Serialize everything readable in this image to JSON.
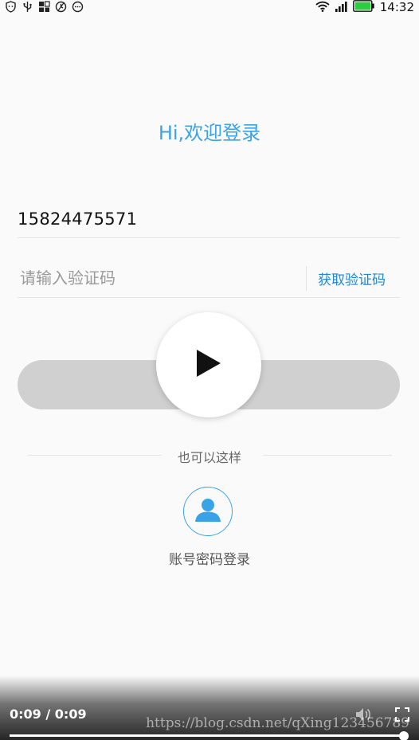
{
  "status_bar": {
    "time": "14:32",
    "icons_left": [
      "shield-icon",
      "usb-icon",
      "apps-icon",
      "no-disturb-icon",
      "more-icon"
    ],
    "icons_right": [
      "wifi-icon",
      "signal-icon",
      "battery-icon"
    ]
  },
  "login": {
    "title": "Hi,欢迎登录",
    "phone_value": "15824475571",
    "code_placeholder": "请输入验证码",
    "get_code_label": "获取验证码",
    "play_icon": "play-icon"
  },
  "alt_login": {
    "divider_label": "也可以这样",
    "account_icon": "user-icon",
    "account_label": "账号密码登录"
  },
  "video": {
    "time": "0:09 / 0:09",
    "progress": 1.0,
    "watermark": "https://blog.csdn.net/qXing123456789"
  },
  "colors": {
    "accent": "#3aa3e8",
    "link": "#1e88d8",
    "button_bar": "#d0d0d0",
    "battery": "#2ecc40"
  }
}
